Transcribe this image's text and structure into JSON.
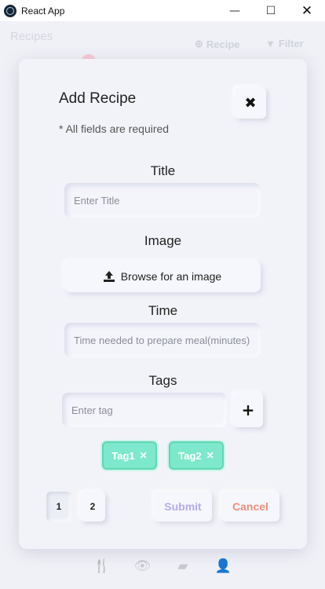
{
  "window": {
    "title": "React App",
    "minimize": "—",
    "maximize": "☐",
    "close": "✕"
  },
  "background": {
    "title": "Recipes",
    "recipe_button": "Recipe",
    "filter_button": "Filter"
  },
  "modal": {
    "title": "Add Recipe",
    "subtitle": "* All fields are required",
    "close_icon": "✖",
    "fields": {
      "title_label": "Title",
      "title_placeholder": "Enter Title",
      "image_label": "Image",
      "image_button": "Browse for an image",
      "time_label": "Time",
      "time_placeholder": "Time needed to prepare meal(minutes)",
      "tags_label": "Tags",
      "tags_placeholder": "Enter tag",
      "add_tag_icon": "+"
    },
    "tags": [
      {
        "label": "Tag1",
        "remove": "✕"
      },
      {
        "label": "Tag2",
        "remove": "✕"
      }
    ],
    "pages": [
      "1",
      "2"
    ],
    "submit_label": "Submit",
    "cancel_label": "Cancel"
  },
  "colors": {
    "tag_bg": "#7de8cc",
    "submit_text": "#b7aaf0",
    "cancel_text": "#f0907c"
  }
}
